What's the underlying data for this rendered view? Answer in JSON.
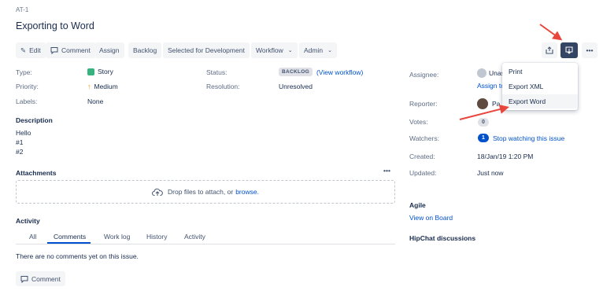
{
  "issue": {
    "key": "AT-1",
    "title": "Exporting to Word"
  },
  "toolbar": {
    "edit": "Edit",
    "comment": "Comment",
    "assign": "Assign",
    "backlog": "Backlog",
    "selected": "Selected for Development",
    "workflow": "Workflow",
    "admin": "Admin"
  },
  "details": {
    "type_label": "Type:",
    "type_value": "Story",
    "priority_label": "Priority:",
    "priority_value": "Medium",
    "labels_label": "Labels:",
    "labels_value": "None",
    "status_label": "Status:",
    "status_value": "BACKLOG",
    "view_workflow": "(View workflow)",
    "resolution_label": "Resolution:",
    "resolution_value": "Unresolved"
  },
  "description": {
    "heading": "Description",
    "lines": [
      "Hello",
      "#1",
      "#2"
    ]
  },
  "attachments": {
    "heading": "Attachments",
    "drop_text": "Drop files to attach, or",
    "browse": "browse."
  },
  "activity": {
    "heading": "Activity",
    "tabs": [
      "All",
      "Comments",
      "Work log",
      "History",
      "Activity"
    ],
    "empty": "There are no comments yet on this issue.",
    "comment_button": "Comment"
  },
  "people": {
    "assignee_label": "Assignee:",
    "assignee_value": "Unas",
    "assign_to_me": "Assign to",
    "reporter_label": "Reporter:",
    "reporter_value": "Pa",
    "votes_label": "Votes:",
    "votes_count": "0",
    "watchers_label": "Watchers:",
    "watchers_count": "1",
    "watch_link": "Stop watching this issue",
    "created_label": "Created:",
    "created_value": "18/Jan/19 1:20 PM",
    "updated_label": "Updated:",
    "updated_value": "Just now"
  },
  "agile": {
    "heading": "Agile",
    "link": "View on Board"
  },
  "hipchat": {
    "heading": "HipChat discussions"
  },
  "export_menu": {
    "items": [
      "Print",
      "Export XML",
      "Export Word"
    ],
    "highlighted": "Export Word"
  },
  "colors": {
    "accent": "#0052cc",
    "arrow": "#e8453c",
    "story": "#36b37e",
    "priority": "#ff8b00"
  }
}
